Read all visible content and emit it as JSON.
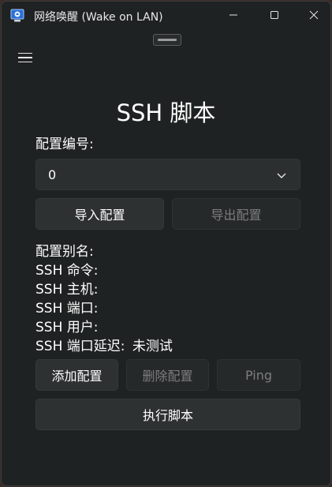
{
  "window": {
    "title": "网络唤醒 (Wake on LAN)"
  },
  "icons": {
    "app": "app-icon",
    "minimize": "minimize-icon",
    "maximize": "maximize-icon",
    "close": "close-icon",
    "menu": "hamburger-menu-icon",
    "dropdown": "chevron-down-icon"
  },
  "page": {
    "title": "SSH 脚本"
  },
  "config": {
    "number_label": "配置编号:",
    "selected_value": "0",
    "import_button": "导入配置",
    "export_button": "导出配置"
  },
  "details": {
    "alias_label": "配置别名:",
    "command_label": "SSH 命令:",
    "host_label": "SSH 主机:",
    "port_label": "SSH 端口:",
    "user_label": "SSH 用户:",
    "latency_label": "SSH 端口延迟:",
    "latency_value": "未测试"
  },
  "actions": {
    "add_button": "添加配置",
    "delete_button": "删除配置",
    "ping_button": "Ping",
    "run_button": "执行脚本"
  },
  "colors": {
    "background": "#1f2222",
    "button": "#2e3131",
    "disabled_text": "#7c7e7e",
    "text": "#ffffff"
  }
}
